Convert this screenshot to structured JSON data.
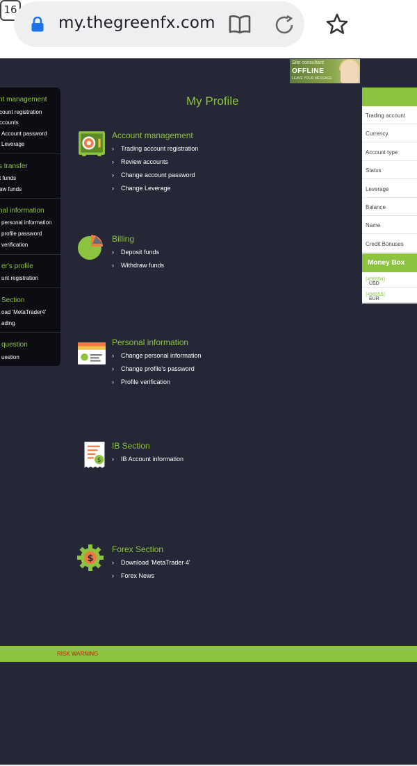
{
  "browser": {
    "url": "my.thegreenfx.com",
    "tab_count": "16"
  },
  "consultant": {
    "label": "Site consultant",
    "status": "OFFLINE",
    "action": "LEAVE YOUR MESSAGE"
  },
  "title": "My Profile",
  "left_menu": {
    "sections": [
      {
        "title": "nt management",
        "items": [
          "count registration",
          "ccounts",
          "Account password",
          "Leverage"
        ]
      },
      {
        "title": "s transfer",
        "items": [
          "t funds",
          "aw funds"
        ]
      },
      {
        "title": "nal information",
        "items": [
          "personal information",
          "profile password",
          "verification"
        ]
      },
      {
        "title": "er's profile",
        "items": [
          "unt registration"
        ]
      },
      {
        "title": "Section",
        "items": [
          "oad 'MetaTrader4'",
          "ading"
        ]
      },
      {
        "title": "question",
        "items": [
          "uestion"
        ]
      }
    ]
  },
  "sections": [
    {
      "title": "Account management",
      "icon": "safe-icon",
      "items": [
        "Trading account registration",
        "Review accounts",
        "Change account password",
        "Change Leverage"
      ]
    },
    {
      "title": "Billing",
      "icon": "pie-chart-icon",
      "items": [
        "Deposit funds",
        "Withdraw funds"
      ]
    },
    {
      "title": "Personal information",
      "icon": "id-card-icon",
      "items": [
        "Change personal information",
        "Change profile's password",
        "Profile verification"
      ]
    },
    {
      "title": "IB Section",
      "icon": "certificate-icon",
      "items": [
        "IB Account information"
      ]
    },
    {
      "title": "Forex Section",
      "icon": "dollar-gear-icon",
      "items": [
        "Download 'MetaTrader 4'",
        "Forex News"
      ]
    }
  ],
  "account_panel": {
    "rows": [
      "Trading account",
      "Currency",
      "Account type",
      "Status",
      "Leverage",
      "Balance",
      "Name",
      "Credit Bonuses"
    ],
    "money_box": {
      "title": "Money Box",
      "rows": [
        {
          "currency": "USD",
          "id": "(498554)"
        },
        {
          "currency": "EUR",
          "id": "(498555)"
        }
      ]
    }
  },
  "footer": {
    "risk_warning": "RISK WARNING"
  },
  "colors": {
    "accent": "#8dc43f",
    "background": "#252636",
    "warning": "#c0200a"
  }
}
